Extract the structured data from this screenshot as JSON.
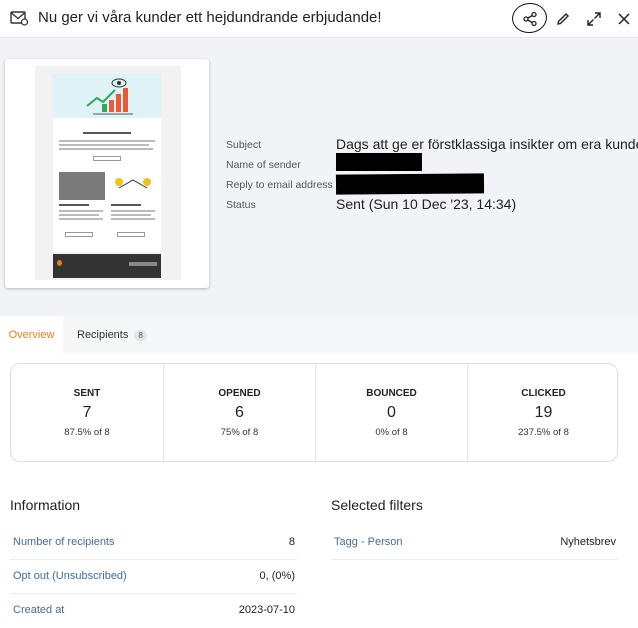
{
  "header": {
    "title": "Nu ger vi våra kunder ett hejdundrande erbjudande!",
    "icons": [
      "mail-icon",
      "share-icon",
      "edit-icon",
      "expand-icon",
      "close-icon"
    ]
  },
  "details": {
    "subject_label": "Subject",
    "subject_value": "Dags att ge er förstklassiga insikter om era kunder!",
    "sender_label": "Name of sender",
    "reply_label": "Reply to email address",
    "status_label": "Status",
    "status_value": "Sent (Sun 10 Dec '23, 14:34)"
  },
  "tabs": [
    {
      "label": "Overview",
      "active": true
    },
    {
      "label": "Recipients",
      "badge": "8"
    }
  ],
  "stats": [
    {
      "label": "SENT",
      "value": "7",
      "sub": "87.5% of 8"
    },
    {
      "label": "OPENED",
      "value": "6",
      "sub": "75% of 8"
    },
    {
      "label": "BOUNCED",
      "value": "0",
      "sub": "0% of 8"
    },
    {
      "label": "CLICKED",
      "value": "19",
      "sub": "237.5% of 8"
    }
  ],
  "information": {
    "title": "Information",
    "rows": [
      {
        "key": "Number of recipients",
        "value": "8"
      },
      {
        "key": "Opt out (Unsubscribed)",
        "value": "0, (0%)"
      },
      {
        "key": "Created at",
        "value": "2023-07-10"
      }
    ]
  },
  "filters": {
    "title": "Selected filters",
    "rows": [
      {
        "key": "Tagg - Person",
        "value": "Nyhetsbrev"
      }
    ]
  },
  "colors": {
    "accent": "#e8801a",
    "link": "#4a6a95",
    "panel_bg": "#f1f3f6"
  }
}
